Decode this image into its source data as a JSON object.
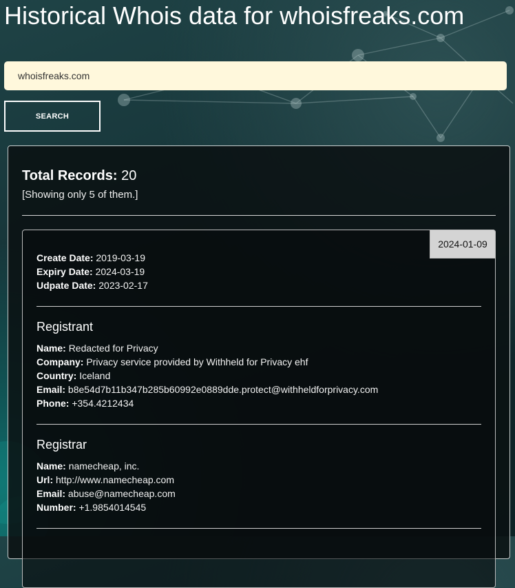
{
  "page": {
    "title": "Historical Whois data for whoisfreaks.com"
  },
  "search": {
    "value": "whoisfreaks.com",
    "button_label": "SEARCH"
  },
  "summary": {
    "total_label": "Total Records:",
    "total_value": "20",
    "showing_note": "[Showing only 5 of them.]"
  },
  "record": {
    "date_badge": "2024-01-09",
    "dates": {
      "create_label": "Create Date:",
      "create_value": "2019-03-19",
      "expiry_label": "Expiry Date:",
      "expiry_value": "2024-03-19",
      "update_label": "Udpate Date:",
      "update_value": "2023-02-17"
    },
    "registrant": {
      "heading": "Registrant",
      "name_label": "Name:",
      "name_value": "Redacted for Privacy",
      "company_label": "Company:",
      "company_value": "Privacy service provided by Withheld for Privacy ehf",
      "country_label": "Country:",
      "country_value": "Iceland",
      "email_label": "Email:",
      "email_value": "b8e54d7b11b347b285b60992e0889dde.protect@withheldforprivacy.com",
      "phone_label": "Phone:",
      "phone_value": "+354.4212434"
    },
    "registrar": {
      "heading": "Registrar",
      "name_label": "Name:",
      "name_value": "namecheap, inc.",
      "url_label": "Url:",
      "url_value": "http://www.namecheap.com",
      "email_label": "Email:",
      "email_value": "abuse@namecheap.com",
      "number_label": "Number:",
      "number_value": "+1.9854014545"
    }
  },
  "colors": {
    "background": "#17363a",
    "input_background": "#fff8dc",
    "panel_background": "#0a1012",
    "badge_background": "#d4d4d4",
    "text": "#ffffff"
  }
}
